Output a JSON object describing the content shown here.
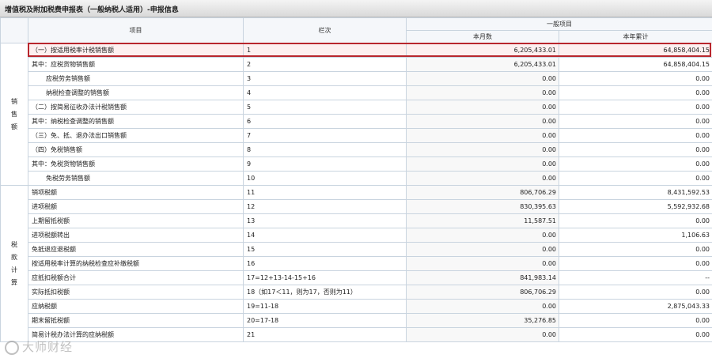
{
  "title": "增值税及附加税费申报表（一般纳税人适用）-申报信息",
  "header": {
    "item": "项目",
    "lane": "栏次",
    "group": "一般项目",
    "month": "本月数",
    "year": "本年累计"
  },
  "groups": {
    "sales": "销售额",
    "tax": "税款计算"
  },
  "rows": [
    {
      "item": "（一）按适用税率计税销售额",
      "lane": "1",
      "month": "6,205,433.01",
      "year": "64,858,404.15"
    },
    {
      "item": "其中：应税货物销售额",
      "lane": "2",
      "month": "6,205,433.01",
      "year": "64,858,404.15"
    },
    {
      "item": "应税劳务销售额",
      "lane": "3",
      "month": "0.00",
      "year": "0.00"
    },
    {
      "item": "纳税检查调整的销售额",
      "lane": "4",
      "month": "0.00",
      "year": "0.00"
    },
    {
      "item": "（二）按简易征收办法计税销售额",
      "lane": "5",
      "month": "0.00",
      "year": "0.00"
    },
    {
      "item": "其中：纳税检查调整的销售额",
      "lane": "6",
      "month": "0.00",
      "year": "0.00"
    },
    {
      "item": "（三）免、抵、退办法出口销售额",
      "lane": "7",
      "month": "0.00",
      "year": "0.00"
    },
    {
      "item": "（四）免税销售额",
      "lane": "8",
      "month": "0.00",
      "year": "0.00"
    },
    {
      "item": "其中：免税货物销售额",
      "lane": "9",
      "month": "0.00",
      "year": "0.00"
    },
    {
      "item": "免税劳务销售额",
      "lane": "10",
      "month": "0.00",
      "year": "0.00"
    },
    {
      "item": "销项税额",
      "lane": "11",
      "month": "806,706.29",
      "year": "8,431,592.53"
    },
    {
      "item": "进项税额",
      "lane": "12",
      "month": "830,395.63",
      "year": "5,592,932.68"
    },
    {
      "item": "上期留抵税额",
      "lane": "13",
      "month": "11,587.51",
      "year": "0.00"
    },
    {
      "item": "进项税额转出",
      "lane": "14",
      "month": "0.00",
      "year": "1,106.63"
    },
    {
      "item": "免抵退应退税额",
      "lane": "15",
      "month": "0.00",
      "year": "0.00"
    },
    {
      "item": "按适用税率计算的纳税检查应补缴税额",
      "lane": "16",
      "month": "0.00",
      "year": "0.00"
    },
    {
      "item": "应抵扣税额合计",
      "lane": "17=12+13-14-15+16",
      "month": "841,983.14",
      "year": "--"
    },
    {
      "item": "实际抵扣税额",
      "lane": "18（如17＜11，则为17，否则为11）",
      "month": "806,706.29",
      "year": "0.00"
    },
    {
      "item": "应纳税额",
      "lane": "19=11-18",
      "month": "0.00",
      "year": "2,875,043.33"
    },
    {
      "item": "期末留抵税额",
      "lane": "20=17-18",
      "month": "35,276.85",
      "year": "0.00"
    },
    {
      "item": "简易计税办法计算的应纳税额",
      "lane": "21",
      "month": "0.00",
      "year": "0.00"
    }
  ],
  "watermark": "大师财经",
  "colors": {
    "highlight_border": "#b8262d",
    "grid_line": "#c9d4df",
    "header_bg": "#f5f7fa"
  }
}
